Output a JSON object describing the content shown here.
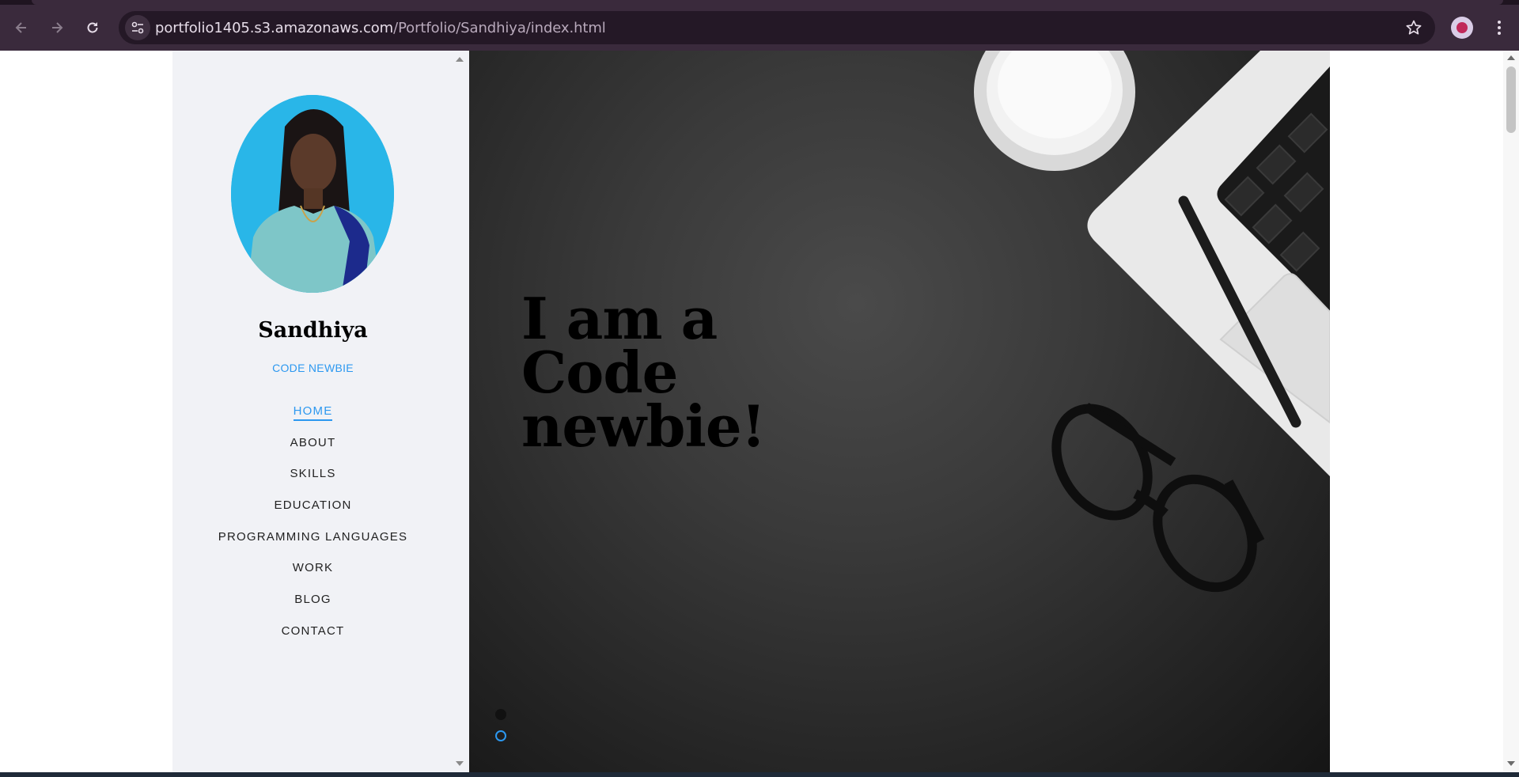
{
  "browser": {
    "back_icon": "arrow-left-icon",
    "forward_icon": "arrow-right-icon",
    "reload_icon": "reload-icon",
    "url_host": "portfolio1405.s3.amazonaws.com",
    "url_path": "/Portfolio/Sandhiya/index.html",
    "bookmark_icon": "star-icon",
    "menu_icon": "kebab-icon"
  },
  "sidebar": {
    "name": "Sandhiya",
    "role": "CODE NEWBIE",
    "menu": [
      {
        "label": "HOME",
        "active": true
      },
      {
        "label": "ABOUT",
        "active": false
      },
      {
        "label": "SKILLS",
        "active": false
      },
      {
        "label": "EDUCATION",
        "active": false
      },
      {
        "label": "PROGRAMMING LANGUAGES",
        "active": false
      },
      {
        "label": "WORK",
        "active": false
      },
      {
        "label": "BLOG",
        "active": false
      },
      {
        "label": "CONTACT",
        "active": false
      }
    ]
  },
  "hero": {
    "line1": "I am a",
    "line2": "Code",
    "line3": "newbie!",
    "slides": 2,
    "active_slide": 1
  },
  "colors": {
    "accent": "#2c98f0",
    "sidebar_bg": "#f1f2f6",
    "chrome_bg": "#3a2a3c"
  }
}
